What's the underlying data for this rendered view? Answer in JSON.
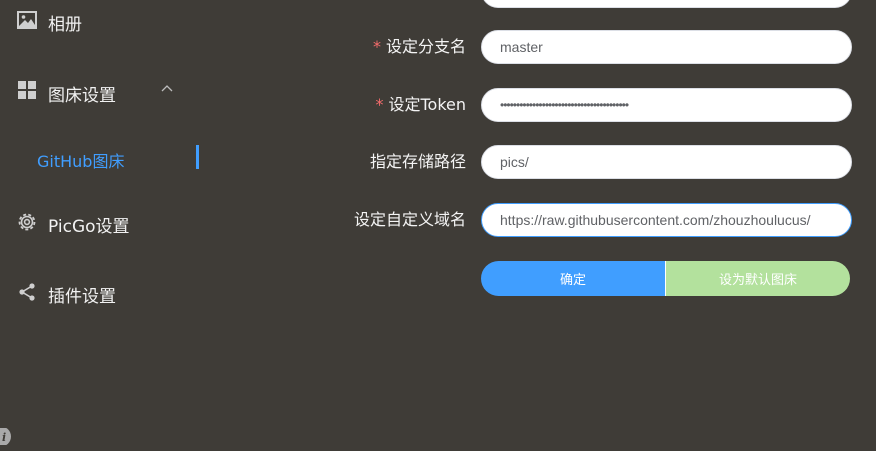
{
  "sidebar": {
    "album_label": "相册",
    "picbed_settings_label": "图床设置",
    "github_picbed_label": "GitHub图床",
    "picgo_settings_label": "PicGo设置",
    "plugin_settings_label": "插件设置"
  },
  "form": {
    "branch_label": "设定分支名",
    "branch_value": "master",
    "token_label": "设定Token",
    "token_value": "••••••••••••••••••••••••••••••••••••••••",
    "path_label": "指定存储路径",
    "path_value": "pics/",
    "domain_label": "设定自定义域名",
    "domain_value": "https://raw.githubusercontent.com/zhouzhoulucus/",
    "required_mark": "*",
    "confirm_label": "确定",
    "set_default_label": "设为默认图床"
  },
  "colors": {
    "background": "#3f3c37",
    "accent": "#409eff",
    "success_light": "#b3e19d",
    "required": "#f56c6c"
  },
  "icons": {
    "album": "picture-icon",
    "picbed": "grid-icon",
    "picgo": "gear-icon",
    "plugin": "share-icon",
    "info": "info-icon"
  }
}
